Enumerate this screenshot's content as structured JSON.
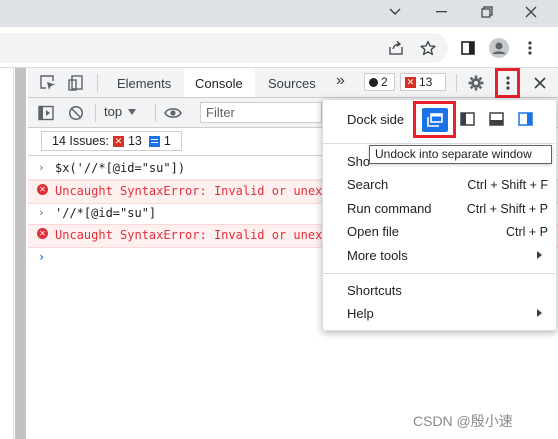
{
  "titlebar": {
    "controls": [
      "chevron-down-icon",
      "minimize-icon",
      "restore-icon",
      "close-icon"
    ]
  },
  "addressbar": {
    "icons": [
      "share-icon",
      "star-icon",
      "side-panel-icon",
      "profile-icon",
      "more-vert-icon"
    ]
  },
  "devtools": {
    "tabs": [
      {
        "label": "Elements"
      },
      {
        "label": "Console",
        "active": true
      },
      {
        "label": "Sources"
      }
    ],
    "more_tabs": "»",
    "errors_count": "2",
    "warnings_count": "13",
    "toolbar": {
      "context": "top",
      "filter_placeholder": "Filter"
    },
    "issues": {
      "label": "14 Issues:",
      "error_count": "13",
      "info_count": "1"
    },
    "console": [
      {
        "type": "input",
        "text": "$x('//*[@id=\"su\"])"
      },
      {
        "type": "error",
        "text": "Uncaught SyntaxError: Invalid or unex"
      },
      {
        "type": "input",
        "text": "'//*[@id=\"su\"]"
      },
      {
        "type": "error",
        "text": "Uncaught SyntaxError: Invalid or unex"
      }
    ]
  },
  "menu": {
    "dock_side_label": "Dock side",
    "tooltip": "Undock into separate window",
    "item_partial": "Sho",
    "items": [
      {
        "label": "Search",
        "shortcut": "Ctrl + Shift + F"
      },
      {
        "label": "Run command",
        "shortcut": "Ctrl + Shift + P"
      },
      {
        "label": "Open file",
        "shortcut": "Ctrl + P"
      },
      {
        "label": "More tools",
        "submenu": true
      }
    ],
    "items2": [
      {
        "label": "Shortcuts"
      },
      {
        "label": "Help",
        "submenu": true
      }
    ]
  },
  "watermark": "CSDN @殷小速",
  "colors": {
    "accent": "#1a73e8",
    "highlight": "#e8202a",
    "error_bg": "#fff0f0",
    "error_text": "#e0303b"
  }
}
